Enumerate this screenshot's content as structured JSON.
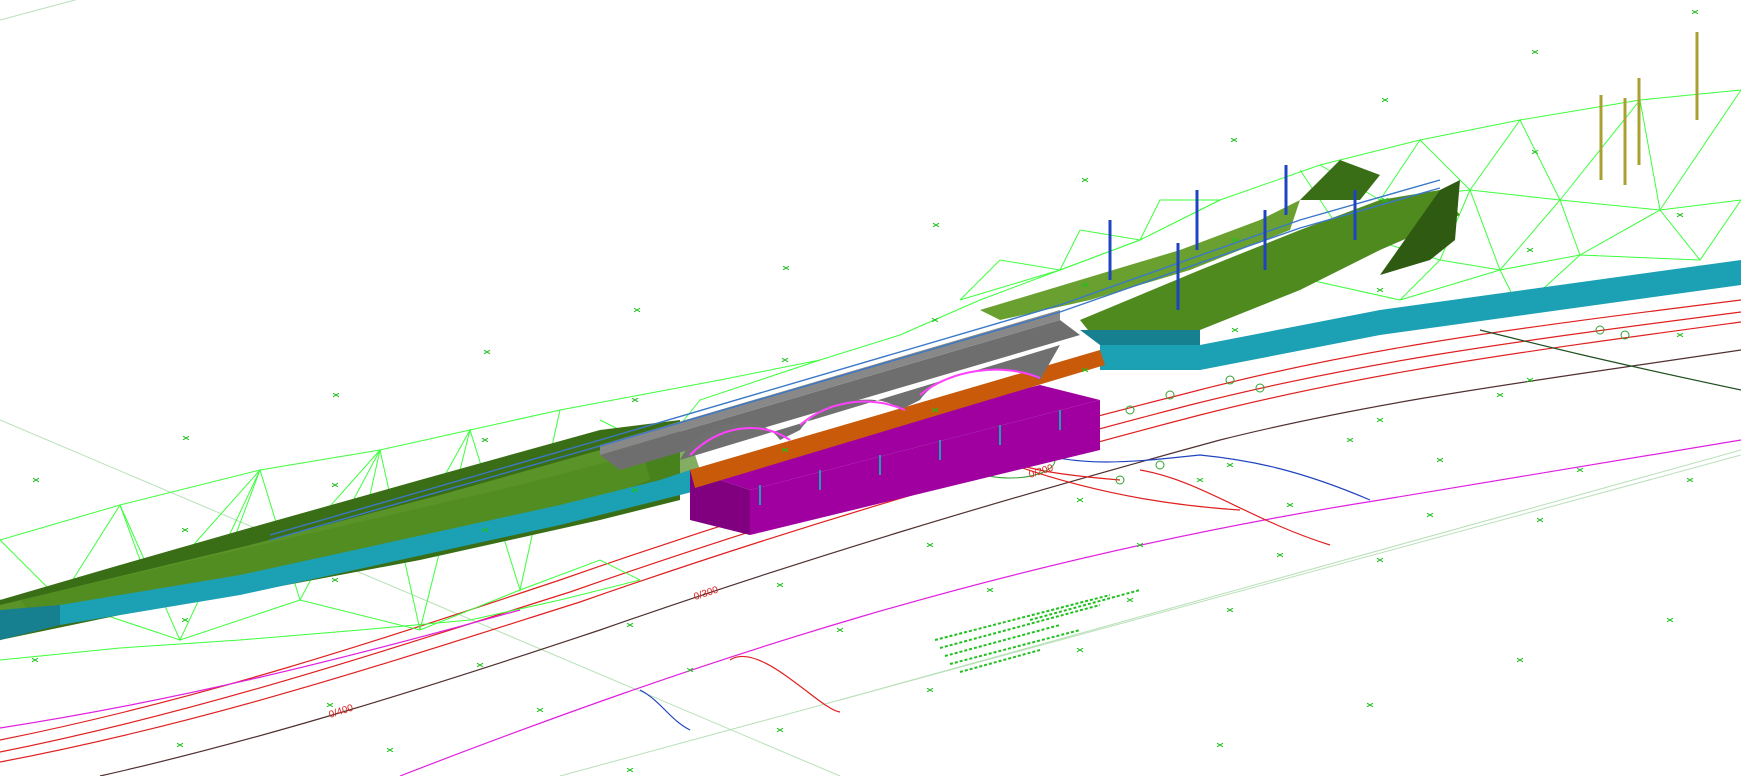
{
  "viewport": {
    "background": "#ffffff"
  },
  "colors": {
    "tin_mesh": "#3cff3c",
    "embankment": "#4f8a1f",
    "embankment_dark": "#3a6e16",
    "retaining_wall": "#1ca0b4",
    "bridge_deck": "#6e6e6e",
    "railing": "#3a78c8",
    "foundation": "#a000a0",
    "beam": "#c85a0a",
    "arch_highlight": "#ff40ff",
    "survey_poles_blue": "#2044c0",
    "survey_poles_olive": "#a8a030",
    "alignment_red": "#e02020",
    "alignment_magenta": "#e020e0",
    "alignment_dark": "#503030",
    "grid_line": "#b8e0b8",
    "annotation_green": "#20c020"
  },
  "icons": {
    "point_marker": "x-cross-icon",
    "pole": "survey-pole-icon"
  },
  "annotations": {
    "station_label_1": "0/400",
    "station_label_2": "0/300",
    "station_label_3": "0/200"
  }
}
